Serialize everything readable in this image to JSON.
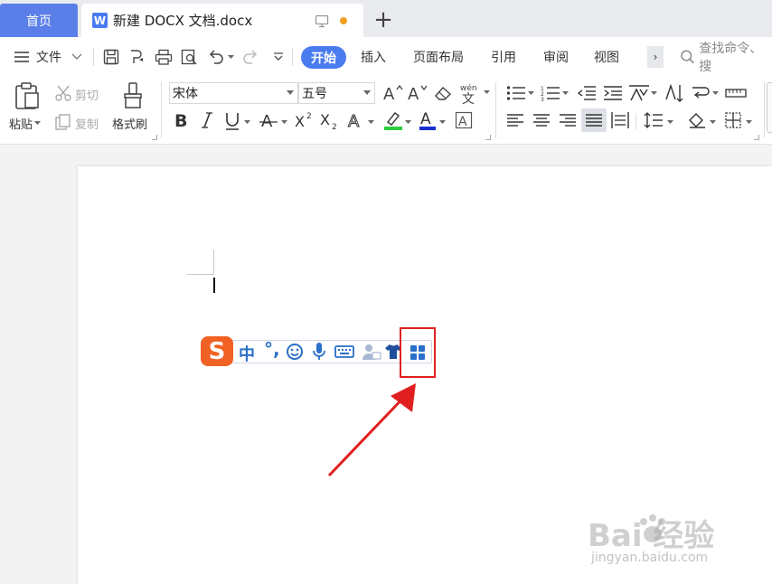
{
  "tabs": {
    "home_label": "首页",
    "doc_title": "新建 DOCX 文档.docx",
    "doc_icon_letter": "W"
  },
  "menu": {
    "hamburger_label": "文件",
    "items": [
      "开始",
      "插入",
      "页面布局",
      "引用",
      "审阅",
      "视图"
    ],
    "search_placeholder": "查找命令、搜"
  },
  "ribbon": {
    "paste_label": "粘贴",
    "cut_label": "剪切",
    "copy_label": "复制",
    "format_painter_label": "格式刷",
    "font_name": "宋体",
    "font_size": "五号"
  },
  "ime": {
    "logo": "S",
    "mode": "中",
    "punct": "°,"
  },
  "watermark": {
    "main": "Bai 经验",
    "sub": "jingyan.baidu.com"
  },
  "colors": {
    "accent": "#4a7cf0",
    "home_tab": "#5b7fe8",
    "ime_logo": "#f06123",
    "ime_icon": "#2a6fc9",
    "highlight_box": "#e02020",
    "arrow": "#e02020"
  }
}
